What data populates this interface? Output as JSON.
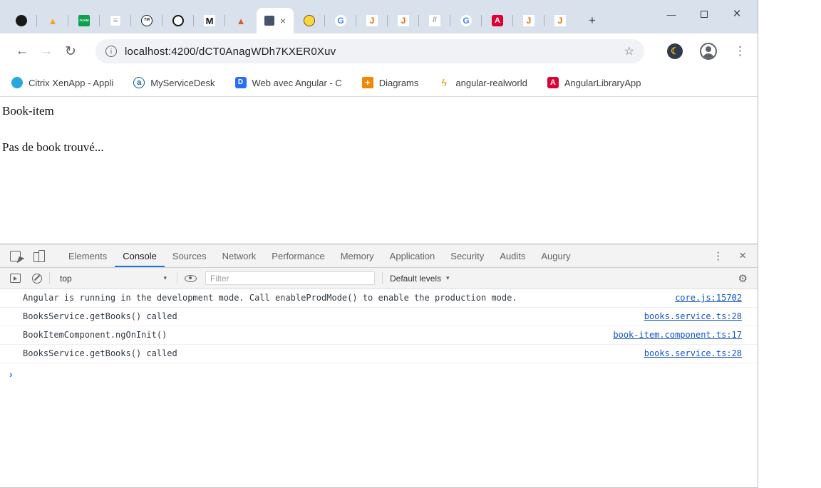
{
  "window_controls": {
    "minimize": "—",
    "close": "×"
  },
  "tabstrip": {
    "tabs_left": [
      {
        "icon": "github-favicon",
        "glyph": "",
        "bg": "#191919",
        "fg": "#ffffff",
        "radius": "50%",
        "size": "8px"
      },
      {
        "icon": "firebase-favicon",
        "glyph": "▲",
        "bg": "transparent",
        "fg": "#f9a11b",
        "radius": "0",
        "size": "13px"
      },
      {
        "icon": "ojam-favicon",
        "glyph": "OJAM",
        "bg": "#0ca04f",
        "fg": "#ffffff",
        "radius": "2px",
        "size": "4.5px",
        "weight": "700"
      },
      {
        "icon": "document-favicon",
        "glyph": "≡",
        "bg": "#ffffff",
        "fg": "#9aa0a6",
        "radius": "2px",
        "size": "11px",
        "border": "1px solid #d5d8dc"
      },
      {
        "icon": "tm-favicon",
        "glyph": "TM",
        "bg": "#ffffff",
        "fg": "#1a1a1a",
        "radius": "50%",
        "size": "5.5px",
        "border": "1.5px solid #1a1a1a",
        "weight": "700"
      },
      {
        "icon": "ring-favicon",
        "glyph": "",
        "bg": "#ffffff",
        "fg": "#000000",
        "radius": "50%",
        "size": "8px",
        "border": "2.5px solid #161616"
      },
      {
        "icon": "medium-favicon",
        "glyph": "M",
        "bg": "#ffffff",
        "fg": "#121212",
        "radius": "0",
        "size": "13px",
        "weight": "700"
      },
      {
        "icon": "flame-favicon",
        "glyph": "▲",
        "bg": "transparent",
        "fg": "#e1561f",
        "radius": "0",
        "size": "13px"
      }
    ],
    "active_tab": {
      "close": "×"
    },
    "tabs_right": [
      {
        "icon": "bee-favicon",
        "glyph": "",
        "bg": "#fdd835",
        "fg": "#4e342e",
        "radius": "50%",
        "size": "8px",
        "border": "1.5px solid #6d4c41"
      },
      {
        "icon": "google-favicon",
        "glyph": "G",
        "bg": "#ffffff",
        "fg": "#4285f4",
        "radius": "50%",
        "size": "12px",
        "weight": "700"
      },
      {
        "icon": "java-favicon",
        "glyph": "J",
        "bg": "#ffffff",
        "fg": "#e76f00",
        "radius": "0",
        "size": "12px",
        "weight": "700"
      },
      {
        "icon": "java-favicon",
        "glyph": "J",
        "bg": "#ffffff",
        "fg": "#e76f00",
        "radius": "0",
        "size": "12px",
        "weight": "700"
      },
      {
        "icon": "slashes-favicon",
        "glyph": "//",
        "bg": "#ffffff",
        "fg": "#9aa0a6",
        "radius": "0",
        "size": "10px",
        "weight": "700"
      },
      {
        "icon": "google-favicon",
        "glyph": "G",
        "bg": "#ffffff",
        "fg": "#4285f4",
        "radius": "50%",
        "size": "12px",
        "weight": "700"
      },
      {
        "icon": "angular-favicon",
        "glyph": "A",
        "bg": "#dd0031",
        "fg": "#ffffff",
        "radius": "3px",
        "size": "11px",
        "weight": "700"
      },
      {
        "icon": "java-favicon",
        "glyph": "J",
        "bg": "#ffffff",
        "fg": "#e76f00",
        "radius": "0",
        "size": "12px",
        "weight": "700"
      },
      {
        "icon": "java-favicon",
        "glyph": "J",
        "bg": "#ffffff",
        "fg": "#e76f00",
        "radius": "0",
        "size": "12px",
        "weight": "700"
      }
    ],
    "new_tab_label": "+"
  },
  "navbar": {
    "back_glyph": "←",
    "forward_glyph": "→",
    "reload_glyph": "↻",
    "info_glyph": "i",
    "url": "localhost:4200/dCT0AnagWDh7KXER0Xuv",
    "star_glyph": "☆",
    "moon_glyph": "☾",
    "menu_glyph": "⋮"
  },
  "bookmarks": [
    {
      "icon": "citrix-icon",
      "glyph": "",
      "bg": "#29a8e0",
      "fg": "#ffffff",
      "radius": "50%",
      "size": "8px",
      "label": "Citrix XenApp - Appli"
    },
    {
      "icon": "myservicedesk-icon",
      "glyph": "a",
      "bg": "#ffffff",
      "fg": "#0b5e8e",
      "radius": "50%",
      "size": "11px",
      "border": "1.5px solid #0b5e8e",
      "weight": "700",
      "label": "MyServiceDesk"
    },
    {
      "icon": "angular-course-icon",
      "glyph": "D",
      "bg": "#2a6df4",
      "fg": "#ffffff",
      "radius": "3px",
      "size": "10px",
      "weight": "700",
      "label": "Web avec Angular - C"
    },
    {
      "icon": "diagrams-icon",
      "glyph": "+",
      "bg": "#f08705",
      "fg": "#ffffff",
      "radius": "2px",
      "size": "12px",
      "weight": "700",
      "label": "Diagrams"
    },
    {
      "icon": "lightning-icon",
      "glyph": "ϟ",
      "bg": "transparent",
      "fg": "#f2a60d",
      "radius": "0",
      "size": "14px",
      "weight": "700",
      "label": "angular-realworld"
    },
    {
      "icon": "angular-icon",
      "glyph": "A",
      "bg": "#dd0031",
      "fg": "#ffffff",
      "radius": "3px",
      "size": "11px",
      "weight": "700",
      "label": "AngularLibraryApp"
    }
  ],
  "page": {
    "heading": "Book-item",
    "message": "Pas de book trouvé..."
  },
  "devtools": {
    "tabs": [
      {
        "label": "Elements"
      },
      {
        "label": "Console"
      },
      {
        "label": "Sources"
      },
      {
        "label": "Network"
      },
      {
        "label": "Performance"
      },
      {
        "label": "Memory"
      },
      {
        "label": "Application"
      },
      {
        "label": "Security"
      },
      {
        "label": "Audits"
      },
      {
        "label": "Augury"
      }
    ],
    "active_tab": "Console",
    "menu_glyph": "⋮",
    "close_glyph": "×",
    "toolbar": {
      "context_label": "top",
      "dropdown_glyph": "▾",
      "filter_placeholder": "Filter",
      "levels_label": "Default levels",
      "gear_glyph": "⚙"
    },
    "messages": [
      {
        "text": "Angular is running in the development mode. Call enableProdMode() to enable the production mode.",
        "source": "core.js:15702"
      },
      {
        "text": "BooksService.getBooks() called",
        "source": "books.service.ts:28"
      },
      {
        "text": "BookItemComponent.ngOnInit()",
        "source": "book-item.component.ts:17"
      },
      {
        "text": "BooksService.getBooks() called",
        "source": "books.service.ts:28"
      }
    ],
    "prompt_glyph": "›"
  }
}
